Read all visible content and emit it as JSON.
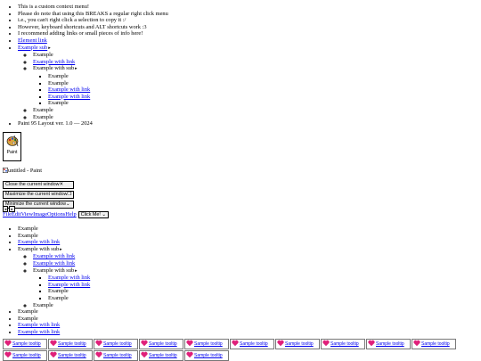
{
  "context_menu": {
    "notes": [
      "This is a custom context menu!",
      "Please do note that using this BREAKS a regular right click menu",
      "i.e., you can't right click a selection to copy it :/",
      "However, keyboard shortcuts and ALT shortcuts work :3",
      "I recommend adding links or small pieces of info here!"
    ],
    "element_link": "Element link",
    "example_sub": "Example sub",
    "sub_items": {
      "a": "Example",
      "b": "Example with link",
      "c": "Example with sub",
      "nested": [
        "Example",
        "Example",
        "Example with link",
        "Example with link",
        "Example"
      ],
      "d": "Example",
      "e": "Example"
    },
    "version": "Paint 95 Layout ver. 1.0 — 2024"
  },
  "paint_tile": {
    "label": "Paint",
    "icon": "palette-icon"
  },
  "window": {
    "title": "untitled - Paint",
    "close_label": "Close the current window",
    "close_glyph": "✕",
    "maximize_label": "Maximize the current window",
    "maximize_glyph": "❐",
    "minimize_label": "Minimize the current window",
    "minimize_glyph": "⌄",
    "prev_glyph": "◂",
    "next_glyph": "▸"
  },
  "menubar": {
    "items": [
      "File",
      "Edit",
      "View",
      "Image",
      "Options",
      "Help"
    ],
    "click_me": "Click Me!",
    "click_me_glyph": "⌄"
  },
  "dropdown": {
    "items": {
      "a": "Example",
      "b": "Example",
      "c": "Example with link",
      "d": "Example with sub",
      "sub": {
        "a": "Example with link",
        "b": "Example with link",
        "c": "Example with sub",
        "nested": [
          "Example with link",
          "Example with link",
          "Example",
          "Example"
        ],
        "d": "Example"
      },
      "e": "Example",
      "f": "Example",
      "g": "Example with link",
      "h": "Example with link"
    }
  },
  "tooltips": {
    "label": "Sample tooltip",
    "icon": "heart-icon",
    "color": "#e0207a",
    "count": 15
  }
}
